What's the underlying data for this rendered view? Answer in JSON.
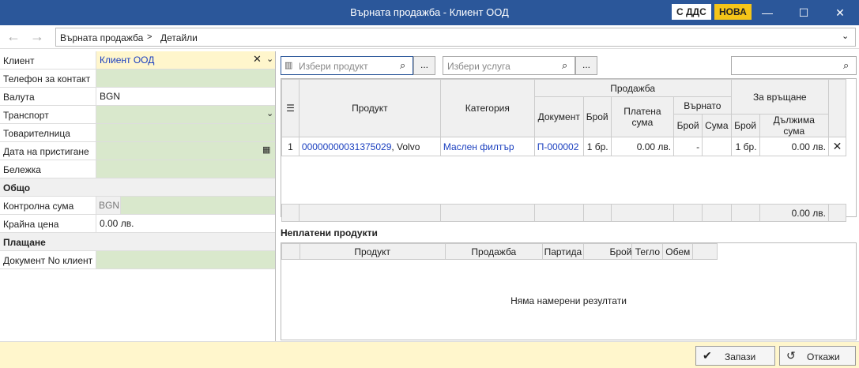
{
  "window": {
    "title": "Върната продажба - Клиент ООД",
    "badge_vat": "С ДДС",
    "badge_new": "НОВА"
  },
  "breadcrumb": {
    "part1": "Върната продажба",
    "separator": ">",
    "part2": "Детайли"
  },
  "form": {
    "client_label": "Клиент",
    "client_value": "Клиент ООД",
    "phone_label": "Телефон за контакт",
    "currency_label": "Валута",
    "currency_value": "BGN",
    "transport_label": "Транспорт",
    "waybill_label": "Товарителница",
    "arrival_label": "Дата на пристигане",
    "note_label": "Бележка",
    "total_section": "Общо",
    "control_label": "Контролна сума",
    "control_currency": "BGN",
    "final_label": "Крайна цена",
    "final_value": "0.00 лв.",
    "payment_section": "Плащане",
    "client_doc_label": "Документ No клиент"
  },
  "search": {
    "product_placeholder": "Избери продукт",
    "service_placeholder": "Избери услуга",
    "dots": "..."
  },
  "grid": {
    "headers": {
      "product": "Продукт",
      "category": "Категория",
      "sale": "Продажба",
      "document": "Документ",
      "count": "Брой",
      "paid": "Платена сума",
      "returned": "Върнато",
      "ret_count": "Брой",
      "ret_sum": "Сума",
      "to_return": "За връщане",
      "tr_count": "Брой",
      "due": "Дължима сума"
    },
    "rows": [
      {
        "num": "1",
        "product_code": "00000000031375029",
        "product_brand": ", Volvo",
        "category": "Маслен филтър",
        "document": "П-000002",
        "count": "1 бр.",
        "paid": "0.00 лв.",
        "ret_count": "-",
        "ret_sum": "",
        "tr_count": "1 бр.",
        "due": "0.00 лв."
      }
    ],
    "total_due": "0.00 лв."
  },
  "unpaid": {
    "title": "Неплатени продукти",
    "headers": {
      "product": "Продукт",
      "sale": "Продажба",
      "batch": "Партида",
      "count": "Брой",
      "weight": "Тегло",
      "volume": "Обем"
    },
    "empty": "Няма намерени резултати"
  },
  "footer": {
    "save": "Запази",
    "cancel": "Откажи"
  },
  "colors": {
    "titlebar": "#2b579a",
    "field_green": "#d9e8cc",
    "field_yellow": "#fff6cc",
    "link_blue": "#1a3fbf",
    "badge_new": "#f5c518"
  }
}
